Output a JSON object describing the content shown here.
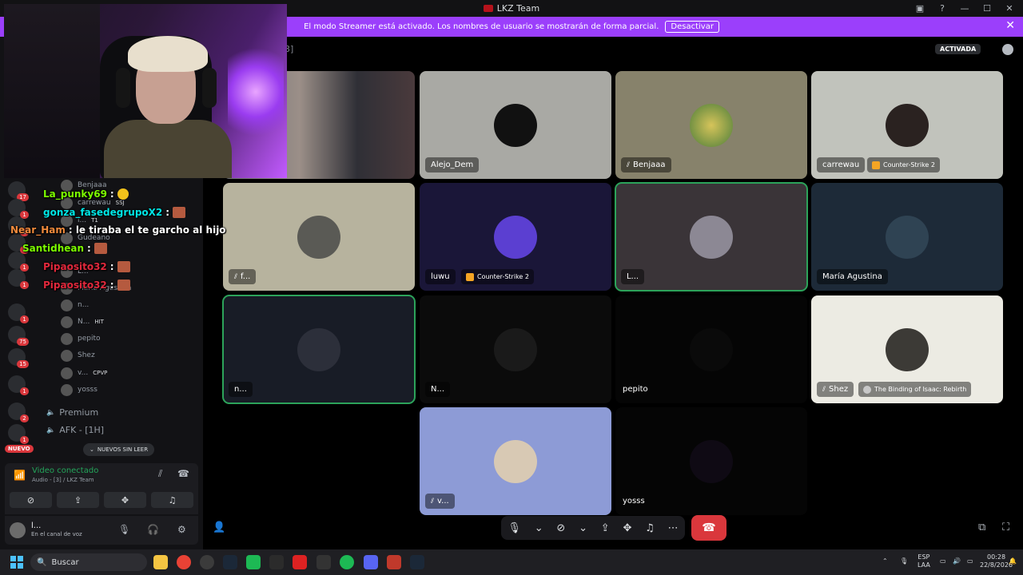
{
  "window": {
    "title": "LKZ Team"
  },
  "streamer_banner": {
    "text": "El modo Streamer está activado. Los nombres de usuario se mostrarán de forma parcial.",
    "button": "Desactivar"
  },
  "header": {
    "activated_label": "ACTIVADA",
    "channel_hint": "3]"
  },
  "voice_channel_users": [
    {
      "name": "Benjaaa",
      "tag": ""
    },
    {
      "name": "carrewau",
      "tag": "SSJ"
    },
    {
      "name": "l...",
      "tag": "T1"
    },
    {
      "name": "Gudeano",
      "tag": ""
    },
    {
      "name": "L...",
      "tag": ""
    },
    {
      "name": "María Agustina",
      "tag": ""
    },
    {
      "name": "n...",
      "tag": ""
    },
    {
      "name": "N...",
      "tag": "HIT"
    },
    {
      "name": "pepito",
      "tag": ""
    },
    {
      "name": "Shez",
      "tag": ""
    },
    {
      "name": "v...",
      "tag": "CPVP"
    },
    {
      "name": "yosss",
      "tag": ""
    }
  ],
  "channels": [
    {
      "name": "Premium"
    },
    {
      "name": "AFK - [1H]"
    }
  ],
  "server_badges": [
    "17",
    "1",
    "1",
    "1",
    "1",
    "1",
    "1",
    "75",
    "15",
    "1",
    "2",
    "1"
  ],
  "chat": [
    {
      "user": "La_punky69",
      "msg": ":",
      "color": "#7CFC00"
    },
    {
      "user": "gonza_fasedegrupoX2",
      "msg": ":",
      "color": "#00E5E5"
    },
    {
      "user": "Near_Ham",
      "msg": ": le tiraba el te garcho al hijo",
      "color": "#F08A3C"
    },
    {
      "user": "Santidhean",
      "msg": ":",
      "color": "#7CFC00"
    },
    {
      "user": "Pipaosito32",
      "msg": ":",
      "color": "#E0283C"
    },
    {
      "user": "Pipaosito32",
      "msg": ":",
      "color": "#E0283C"
    }
  ],
  "nuevos_sin_leer": "NUEVOS SIN LEER",
  "nuevo_badge": "NUEVO",
  "voice_panel": {
    "status": "Video conectado",
    "sub": "Audio - [3] / LKZ Team"
  },
  "user_panel": {
    "name": "l...",
    "status": "En el canal de voz"
  },
  "tiles": [
    {
      "name": "",
      "activity": ""
    },
    {
      "name": "Alejo_Dem",
      "activity": ""
    },
    {
      "name": "Benjaaa",
      "activity": ""
    },
    {
      "name": "carrewau",
      "activity": "Counter-Strike 2"
    },
    {
      "name": "f...",
      "activity": ""
    },
    {
      "name": "luwu",
      "activity": "Counter-Strike 2"
    },
    {
      "name": "L...",
      "activity": ""
    },
    {
      "name": "María Agustina",
      "activity": ""
    },
    {
      "name": "n...",
      "activity": ""
    },
    {
      "name": "N...",
      "activity": ""
    },
    {
      "name": "pepito",
      "activity": ""
    },
    {
      "name": "Shez",
      "activity": "The Binding of Isaac: Rebirth"
    },
    {
      "name": "v...",
      "activity": ""
    },
    {
      "name": "yosss",
      "activity": ""
    }
  ],
  "taskbar": {
    "search": "Buscar",
    "lang_top": "ESP",
    "lang_bottom": "LAA",
    "time": "00:28",
    "date": "22/8/2026"
  },
  "colors": {
    "accent": "#9B3FFB",
    "speaking": "#2CA35A",
    "hangup": "#DA373C"
  }
}
